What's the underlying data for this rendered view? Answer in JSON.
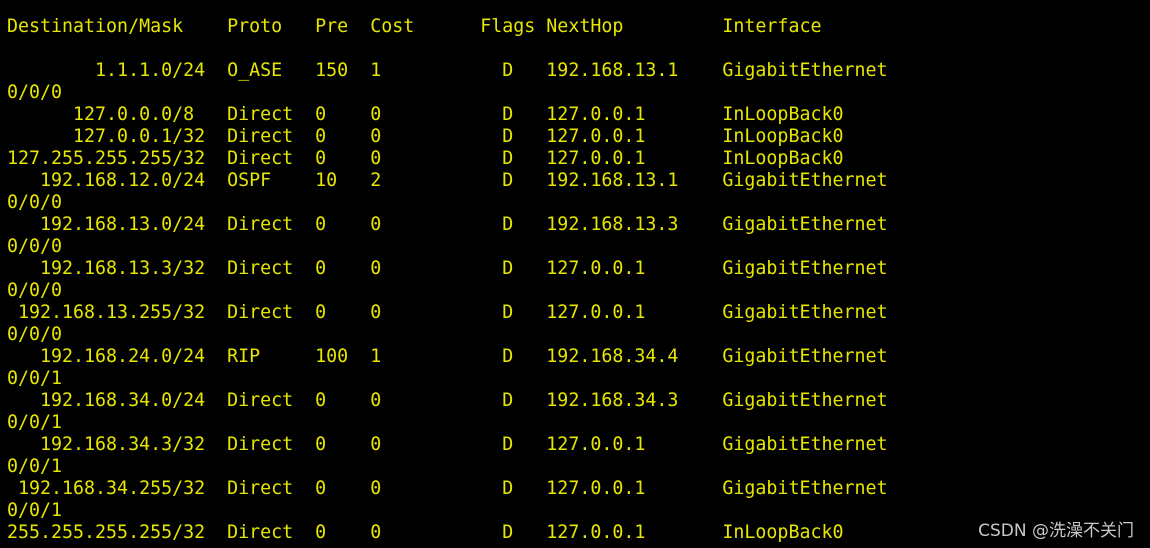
{
  "terminal": {
    "text_color": "#E6E600",
    "background_color": "#000000",
    "header": "Destination/Mask    Proto   Pre  Cost      Flags NextHop         Interface",
    "lines": [
      "        1.1.1.0/24  O_ASE   150  1           D   192.168.13.1    GigabitEthernet",
      "0/0/0",
      "      127.0.0.0/8   Direct  0    0           D   127.0.0.1       InLoopBack0",
      "      127.0.0.1/32  Direct  0    0           D   127.0.0.1       InLoopBack0",
      "127.255.255.255/32  Direct  0    0           D   127.0.0.1       InLoopBack0",
      "   192.168.12.0/24  OSPF    10   2           D   192.168.13.1    GigabitEthernet",
      "0/0/0",
      "   192.168.13.0/24  Direct  0    0           D   192.168.13.3    GigabitEthernet",
      "0/0/0",
      "   192.168.13.3/32  Direct  0    0           D   127.0.0.1       GigabitEthernet",
      "0/0/0",
      " 192.168.13.255/32  Direct  0    0           D   127.0.0.1       GigabitEthernet",
      "0/0/0",
      "   192.168.24.0/24  RIP     100  1           D   192.168.34.4    GigabitEthernet",
      "0/0/1",
      "   192.168.34.0/24  Direct  0    0           D   192.168.34.3    GigabitEthernet",
      "0/0/1",
      "   192.168.34.3/32  Direct  0    0           D   127.0.0.1       GigabitEthernet",
      "0/0/1",
      " 192.168.34.255/32  Direct  0    0           D   127.0.0.1       GigabitEthernet",
      "0/0/1",
      "255.255.255.255/32  Direct  0    0           D   127.0.0.1       InLoopBack0"
    ]
  },
  "watermark": "CSDN @洗澡不关门"
}
